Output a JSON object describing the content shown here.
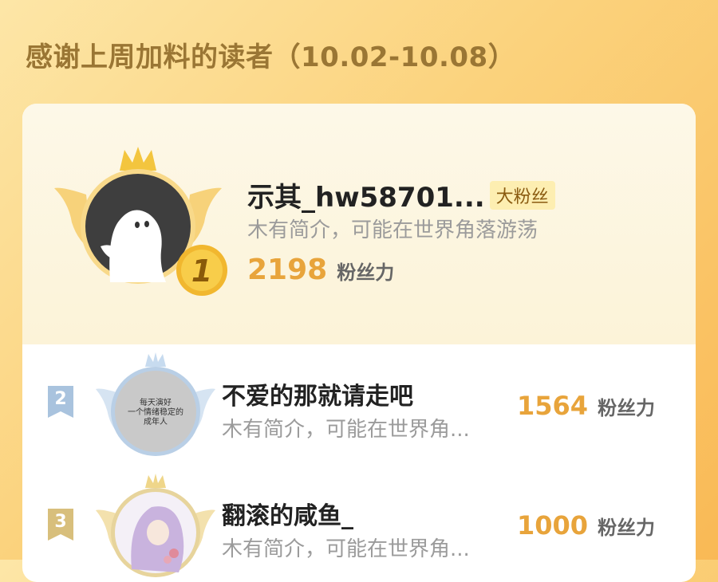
{
  "header": {
    "title": "感谢上周加料的读者（10.02-10.08）"
  },
  "colors": {
    "accent": "#e8a43b",
    "title": "#9a7634",
    "badge_bg": "#fdeeb1"
  },
  "top_reader": {
    "rank": "1",
    "name": "示其_hw58701...",
    "badge": "大粉丝",
    "bio": "木有简介，可能在世界角落游荡",
    "score": "2198",
    "unit": "粉丝力",
    "avatar_icon": "ghost-avatar"
  },
  "readers": [
    {
      "rank": "2",
      "name": "不爱的那就请走吧",
      "bio": "木有简介，可能在世界角...",
      "score": "1564",
      "unit": "粉丝力",
      "avatar_text": [
        "每天演好",
        "一个情绪稳定的",
        "成年人"
      ]
    },
    {
      "rank": "3",
      "name": "翻滚的咸鱼_",
      "bio": "木有简介，可能在世界角...",
      "score": "1000",
      "unit": "粉丝力",
      "avatar_icon": "illustrated-girl-avatar"
    }
  ]
}
